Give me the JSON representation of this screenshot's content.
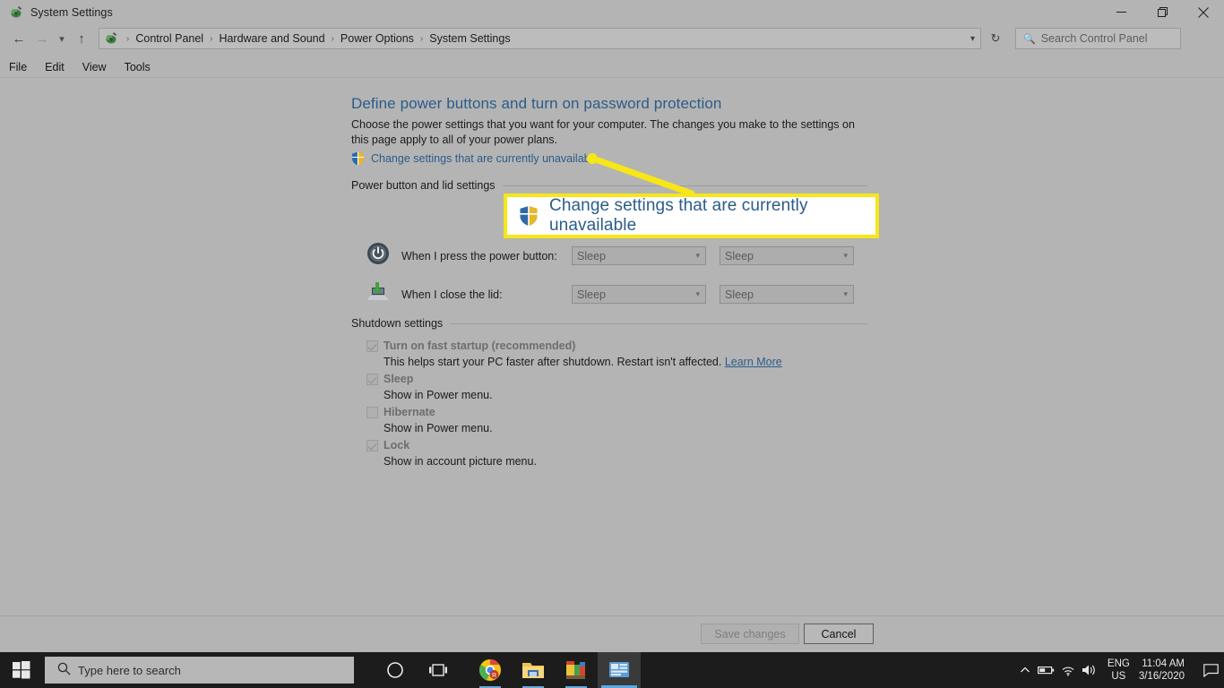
{
  "window": {
    "title": "System Settings",
    "icon": "system-settings-icon",
    "controls": {
      "minimize": "minimize-icon",
      "maximize": "maximize-icon",
      "close": "close-icon"
    }
  },
  "addressbar": {
    "back": "back-arrow-icon",
    "forward": "forward-arrow-icon",
    "history": "history-chevron-icon",
    "up": "up-arrow-icon",
    "breadcrumbs": [
      "Control Panel",
      "Hardware and Sound",
      "Power Options",
      "System Settings"
    ],
    "separator": "›",
    "dropdown_caret": "⌄",
    "refresh": "refresh-icon",
    "search_placeholder": "Search Control Panel",
    "search_value": "",
    "search_icon": "search-icon"
  },
  "menubar": {
    "items": [
      "File",
      "Edit",
      "View",
      "Tools"
    ]
  },
  "page": {
    "title": "Define power buttons and turn on password protection",
    "description": "Choose the power settings that you want for your computer. The changes you make to the settings on this page apply to all of your power plans.",
    "uac_link": "Change settings that are currently unavailable",
    "uac_icon": "uac-shield-icon"
  },
  "power_group": {
    "label": "Power button and lid settings",
    "rows": [
      {
        "icon": "power-button-icon",
        "label": "When I press the power button:",
        "on_battery": "Sleep",
        "plugged_in": "Sleep"
      },
      {
        "icon": "laptop-lid-icon",
        "label": "When I close the lid:",
        "on_battery": "Sleep",
        "plugged_in": "Sleep"
      }
    ],
    "dropdown_caret": "⌄"
  },
  "shutdown_group": {
    "label": "Shutdown settings",
    "items": [
      {
        "label": "Turn on fast startup (recommended)",
        "checked": true,
        "sub": "This helps start your PC faster after shutdown. Restart isn't affected.",
        "link": "Learn More"
      },
      {
        "label": "Sleep",
        "checked": true,
        "sub": "Show in Power menu.",
        "link": ""
      },
      {
        "label": "Hibernate",
        "checked": false,
        "sub": "Show in Power menu.",
        "link": ""
      },
      {
        "label": "Lock",
        "checked": true,
        "sub": "Show in account picture menu.",
        "link": ""
      }
    ]
  },
  "buttons": {
    "save": "Save changes",
    "cancel": "Cancel"
  },
  "callout": {
    "text": "Change settings that are currently unavailable",
    "icon": "uac-shield-icon",
    "border_color": "#f7e618",
    "text_color": "#2b5c8a"
  },
  "taskbar": {
    "start": "windows-start-icon",
    "search_placeholder": "Type here to search",
    "search_icon": "search-icon",
    "icons": [
      "cortana-icon",
      "task-view-icon",
      "chrome-icon",
      "file-explorer-icon",
      "paint-app-icon",
      "control-panel-icon"
    ],
    "tray": {
      "show_hidden": "chevron-up-icon",
      "battery": "battery-icon",
      "network": "wifi-icon",
      "volume": "volume-icon",
      "language_line1": "ENG",
      "language_line2": "US",
      "time": "11:04 AM",
      "date": "3/16/2020",
      "notifications": "notification-icon"
    }
  },
  "colors": {
    "window_bg": "#b4b4b4",
    "link": "#2b5c8a",
    "highlight": "#f7e618",
    "taskbar": "#1c1c1c"
  }
}
